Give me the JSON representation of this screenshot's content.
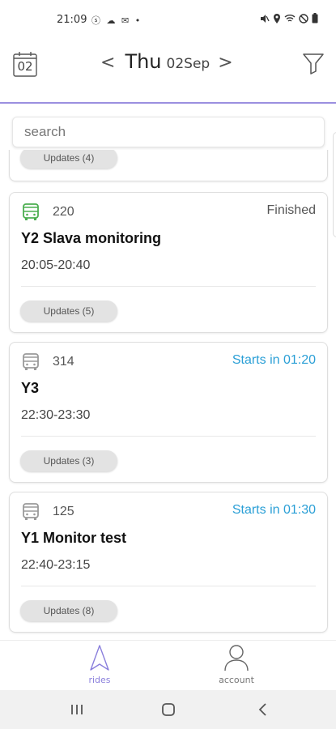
{
  "statusbar": {
    "time": "21:09",
    "left_icons": "ⓢ ☁ ✉ •"
  },
  "header": {
    "calendar_day": "02",
    "prev_symbol": "<",
    "next_symbol": ">",
    "day_name": "Thu",
    "date": "02Sep"
  },
  "search": {
    "placeholder": "search"
  },
  "partial_card": {
    "updates_label": "Updates (4)"
  },
  "rides": [
    {
      "number": "220",
      "status": "Finished",
      "status_color": "#555555",
      "icon_color": "#4caf50",
      "title": "Y2 Slava monitoring",
      "time": "20:05-20:40",
      "updates_label": "Updates (5)"
    },
    {
      "number": "314",
      "status": "Starts in 01:20",
      "status_color": "#2a9fd6",
      "icon_color": "#9a9a9a",
      "title": "Y3",
      "time": "22:30-23:30",
      "updates_label": "Updates (3)"
    },
    {
      "number": "125",
      "status": "Starts in 01:30",
      "status_color": "#2a9fd6",
      "icon_color": "#9a9a9a",
      "title": "Y1 Monitor test",
      "time": "22:40-23:15",
      "updates_label": "Updates (8)"
    }
  ],
  "bottom_nav": {
    "rides_label": "rides",
    "account_label": "account",
    "active_color": "#8a7fdc"
  }
}
